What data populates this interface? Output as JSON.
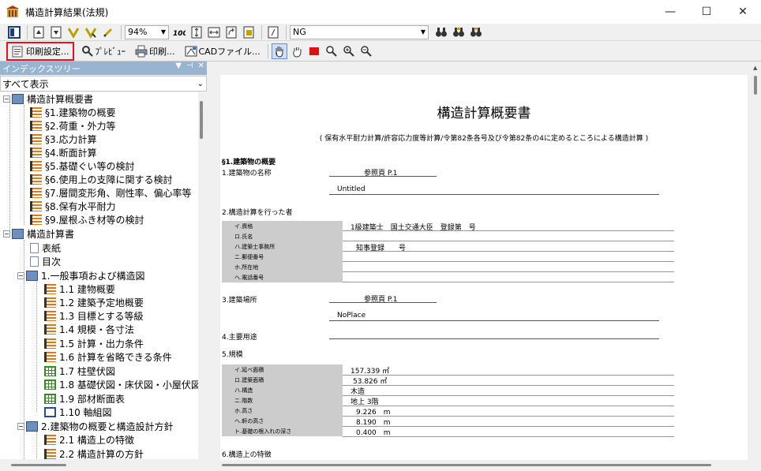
{
  "window": {
    "title": "構造計算結果(法規)",
    "minimize": "—",
    "maximize": "☐",
    "close": "✕"
  },
  "toolbar1": {
    "zoom": "94%",
    "filter": "NG"
  },
  "toolbar2": {
    "print_settings": "印刷設定...",
    "preview": "ﾌﾟﾚﾋﾞｭｰ",
    "print": "印刷...",
    "cad_file": "CADファイル..."
  },
  "index_panel": {
    "title": "インデックスツリー",
    "filter": "すべて表示"
  },
  "tree": [
    {
      "label": "構造計算概要書"
    },
    {
      "label": "§1.建築物の概要"
    },
    {
      "label": "§2.荷重・外力等"
    },
    {
      "label": "§3.応力計算"
    },
    {
      "label": "§4.断面計算"
    },
    {
      "label": "§5.基礎ぐい等の検討"
    },
    {
      "label": "§6.使用上の支障に関する検討"
    },
    {
      "label": "§7.層間変形角、剛性率、偏心率等"
    },
    {
      "label": "§8.保有水平耐力"
    },
    {
      "label": "§9.屋根ふき材等の検討"
    },
    {
      "label": "構造計算書"
    },
    {
      "label": "表紙"
    },
    {
      "label": "目次"
    },
    {
      "label": "1.一般事項および構造図"
    },
    {
      "label": "1.1 建物概要"
    },
    {
      "label": "1.2 建築予定地概要"
    },
    {
      "label": "1.3 目標とする等級"
    },
    {
      "label": "1.4 規模・各寸法"
    },
    {
      "label": "1.5 計算・出力条件"
    },
    {
      "label": "1.6 計算を省略できる条件"
    },
    {
      "label": "1.7 柱壁伏図"
    },
    {
      "label": "1.8 基礎伏図・床伏図・小屋伏図"
    },
    {
      "label": "1.9 部材断面表"
    },
    {
      "label": "1.10 軸組図"
    },
    {
      "label": "2.建築物の概要と構造設計方針"
    },
    {
      "label": "2.1 構造上の特徴"
    },
    {
      "label": "2.2 構造計算の方針"
    }
  ],
  "doc": {
    "title": "構造計算概要書",
    "subtitle": "( 保有水平耐力計算/許容応力度等計算/令第82条各号及び令第82条の4に定めるところによる構造計算 )",
    "section1": "§1.建築物の概要",
    "item1": "1.建築物の名称",
    "ref": "参照頁 P.1",
    "name_value": "Untitled",
    "item2": "2.構造計算を行った者",
    "engineer": {
      "labels": [
        "イ.資格",
        "ロ.氏名",
        "ハ.建築士事務所",
        "ニ.郵便番号",
        "ホ.所在地",
        "ヘ.電話番号"
      ],
      "qualification": "1級建築士　国土交通大臣　登録第　号",
      "office": "知事登録　　号"
    },
    "item3": "3.建築場所",
    "ref3": "参照頁 P.1",
    "place_value": "NoPlace",
    "item4": "4.主要用途",
    "item5": "5.規模",
    "scale": {
      "labels": [
        "イ.延べ面積",
        "ロ.建築面積",
        "ハ.構造",
        "ニ.階数",
        "ホ.高さ",
        "ヘ.軒の高さ",
        "ト.基礎の根入れの深さ"
      ],
      "values": [
        "157.339 ㎡",
        "53.826 ㎡",
        "木造",
        "地上 3階",
        "9.226　m",
        "8.190　m",
        "0.400　m"
      ]
    },
    "item6": "6.構造上の特徴"
  }
}
